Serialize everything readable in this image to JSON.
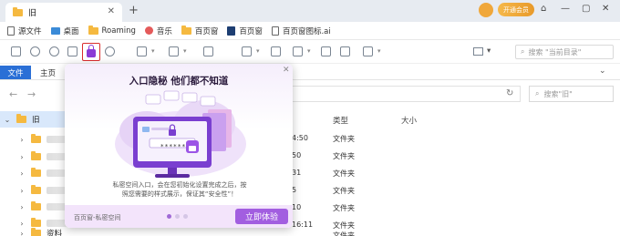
{
  "titlebar": {
    "tab_label": "旧",
    "tab_close": "✕",
    "new_tab": "+",
    "vip_label": "开通会员",
    "controls": [
      "⌂",
      "—",
      "▢",
      "✕"
    ]
  },
  "bookmarks": [
    "源文件",
    "桌面",
    "Roaming",
    "音乐",
    "百页窗",
    "百页窗",
    "百页窗图标.ai"
  ],
  "toolbar": {
    "view_label": "▾",
    "search_placeholder": "搜索 \"当前目录\""
  },
  "ribbon": {
    "file_tab": "文件",
    "home_tab": "主页",
    "collapse": "⌄"
  },
  "address": {
    "back": "←",
    "forward": "→",
    "refresh": "↻",
    "search_placeholder": "搜索\"旧\""
  },
  "tree": {
    "items": [
      {
        "label": "旧",
        "arrow": "⌄",
        "selected": true
      },
      {
        "label": "",
        "arrow": "›"
      },
      {
        "label": "",
        "arrow": "›"
      },
      {
        "label": "",
        "arrow": "›"
      },
      {
        "label": "",
        "arrow": "›"
      },
      {
        "label": "",
        "arrow": "›"
      },
      {
        "label": "",
        "arrow": "›"
      },
      {
        "label": "资料",
        "arrow": "›"
      }
    ]
  },
  "filelist": {
    "headers": [
      "类型",
      "大小"
    ],
    "rows": [
      {
        "time": "4:50",
        "type": "文件夹"
      },
      {
        "time": "50",
        "type": "文件夹"
      },
      {
        "time": "31",
        "type": "文件夹"
      },
      {
        "time": "5",
        "type": "文件夹"
      },
      {
        "time": "10",
        "type": "文件夹"
      },
      {
        "time": "16:11",
        "type": "文件夹"
      },
      {
        "time": "",
        "type": "文件夹"
      }
    ]
  },
  "popup": {
    "close": "✕",
    "title": "入口隐秘 他们都不知道",
    "desc_line1": "私密空间入口，会在您初始化设置完成之后，按",
    "desc_line2": "照您需要的样式展示，保证其“安全性”！",
    "brand": "百页窗-私密空间",
    "cta": "立即体验",
    "password_mask": "* * * * * *"
  },
  "colors": {
    "accent": "#2a6fd6",
    "lock_highlight": "#d92c2c",
    "brand_purple": "#a25ee0",
    "folder": "#f5b940"
  }
}
